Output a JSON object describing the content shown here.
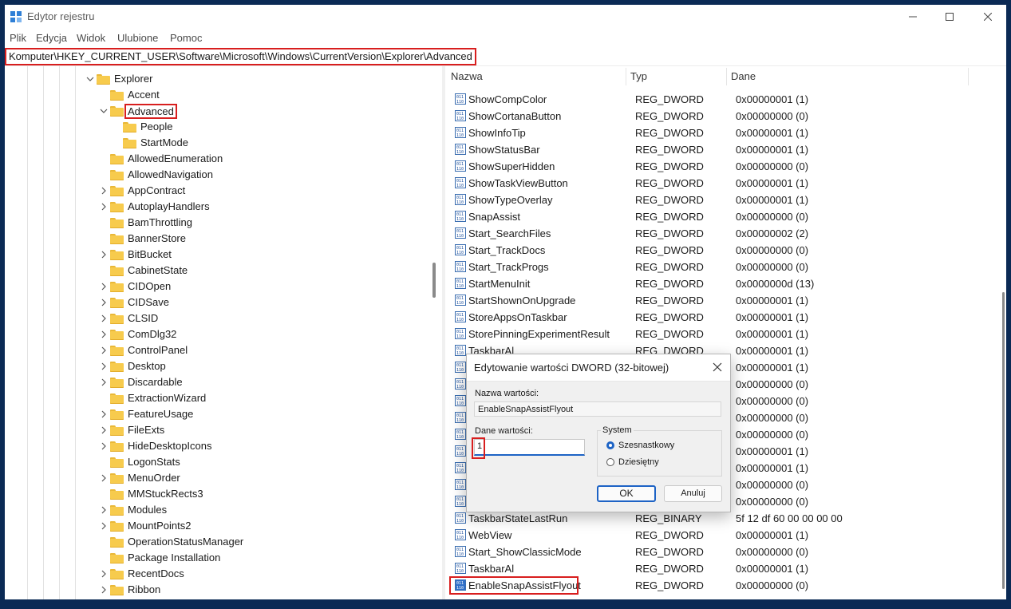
{
  "window": {
    "title": "Edytor rejestru"
  },
  "menu": [
    "Plik",
    "Edycja",
    "Widok",
    "Ulubione",
    "Pomoc"
  ],
  "address": "Komputer\\HKEY_CURRENT_USER\\Software\\Microsoft\\Windows\\CurrentVersion\\Explorer\\Advanced",
  "tree": {
    "parent": "Explorer",
    "children": [
      {
        "label": "Accent"
      },
      {
        "label": "Advanced",
        "highlighted": true,
        "expanded": true
      },
      {
        "label": "People"
      },
      {
        "label": "StartMode"
      },
      {
        "label": "AllowedEnumeration"
      },
      {
        "label": "AllowedNavigation"
      },
      {
        "label": "AppContract"
      },
      {
        "label": "AutoplayHandlers"
      },
      {
        "label": "BamThrottling"
      },
      {
        "label": "BannerStore"
      },
      {
        "label": "BitBucket"
      },
      {
        "label": "CabinetState"
      },
      {
        "label": "CIDOpen"
      },
      {
        "label": "CIDSave"
      },
      {
        "label": "CLSID"
      },
      {
        "label": "ComDlg32"
      },
      {
        "label": "ControlPanel"
      },
      {
        "label": "Desktop"
      },
      {
        "label": "Discardable"
      },
      {
        "label": "ExtractionWizard"
      },
      {
        "label": "FeatureUsage"
      },
      {
        "label": "FileExts"
      },
      {
        "label": "HideDesktopIcons"
      },
      {
        "label": "LogonStats"
      },
      {
        "label": "MenuOrder"
      },
      {
        "label": "MMStuckRects3"
      },
      {
        "label": "Modules"
      },
      {
        "label": "MountPoints2"
      },
      {
        "label": "OperationStatusManager"
      },
      {
        "label": "Package Installation"
      },
      {
        "label": "RecentDocs"
      },
      {
        "label": "Ribbon"
      }
    ]
  },
  "list": {
    "columns": [
      "Nazwa",
      "Typ",
      "Dane"
    ],
    "rows": [
      {
        "name": "ShowCompColor",
        "type": "REG_DWORD",
        "data": "0x00000001 (1)"
      },
      {
        "name": "ShowCortanaButton",
        "type": "REG_DWORD",
        "data": "0x00000000 (0)"
      },
      {
        "name": "ShowInfoTip",
        "type": "REG_DWORD",
        "data": "0x00000001 (1)"
      },
      {
        "name": "ShowStatusBar",
        "type": "REG_DWORD",
        "data": "0x00000001 (1)"
      },
      {
        "name": "ShowSuperHidden",
        "type": "REG_DWORD",
        "data": "0x00000000 (0)"
      },
      {
        "name": "ShowTaskViewButton",
        "type": "REG_DWORD",
        "data": "0x00000001 (1)"
      },
      {
        "name": "ShowTypeOverlay",
        "type": "REG_DWORD",
        "data": "0x00000001 (1)"
      },
      {
        "name": "SnapAssist",
        "type": "REG_DWORD",
        "data": "0x00000000 (0)"
      },
      {
        "name": "Start_SearchFiles",
        "type": "REG_DWORD",
        "data": "0x00000002 (2)"
      },
      {
        "name": "Start_TrackDocs",
        "type": "REG_DWORD",
        "data": "0x00000000 (0)"
      },
      {
        "name": "Start_TrackProgs",
        "type": "REG_DWORD",
        "data": "0x00000000 (0)"
      },
      {
        "name": "StartMenuInit",
        "type": "REG_DWORD",
        "data": "0x0000000d (13)"
      },
      {
        "name": "StartShownOnUpgrade",
        "type": "REG_DWORD",
        "data": "0x00000001 (1)"
      },
      {
        "name": "StoreAppsOnTaskbar",
        "type": "REG_DWORD",
        "data": "0x00000001 (1)"
      },
      {
        "name": "StorePinningExperimentResult",
        "type": "REG_DWORD",
        "data": "0x00000001 (1)"
      },
      {
        "name": "TaskbarAl",
        "type": "REG_DWORD",
        "data": "0x00000001 (1)"
      },
      {
        "name": "",
        "type": "",
        "data": "0x00000001 (1)"
      },
      {
        "name": "",
        "type": "",
        "data": "0x00000000 (0)"
      },
      {
        "name": "",
        "type": "",
        "data": "0x00000000 (0)"
      },
      {
        "name": "",
        "type": "",
        "data": "0x00000000 (0)"
      },
      {
        "name": "",
        "type": "",
        "data": "0x00000000 (0)"
      },
      {
        "name": "",
        "type": "",
        "data": "0x00000001 (1)"
      },
      {
        "name": "",
        "type": "",
        "data": "0x00000001 (1)"
      },
      {
        "name": "",
        "type": "",
        "data": "0x00000000 (0)"
      },
      {
        "name": "",
        "type": "",
        "data": "0x00000000 (0)"
      },
      {
        "name": "TaskbarStateLastRun",
        "type": "REG_BINARY",
        "data": "5f 12 df 60 00 00 00 00"
      },
      {
        "name": "WebView",
        "type": "REG_DWORD",
        "data": "0x00000001 (1)"
      },
      {
        "name": "Start_ShowClassicMode",
        "type": "REG_DWORD",
        "data": "0x00000000 (0)"
      },
      {
        "name": "TaskbarAl",
        "type": "REG_DWORD",
        "data": "0x00000001 (1)"
      },
      {
        "name": "EnableSnapAssistFlyout",
        "type": "REG_DWORD",
        "data": "0x00000000 (0)",
        "highlighted": true
      }
    ]
  },
  "dialog": {
    "title": "Edytowanie wartości DWORD (32-bitowej)",
    "name_label": "Nazwa wartości:",
    "name_value": "EnableSnapAssistFlyout",
    "data_label": "Dane wartości:",
    "data_value": "1",
    "base_label": "System",
    "base_options": [
      "Szesnastkowy",
      "Dziesiętny"
    ],
    "base_selected": "Szesnastkowy",
    "ok_label": "OK",
    "cancel_label": "Anuluj"
  },
  "colors": {
    "highlight": "#d81e1e",
    "accent": "#1d63c5",
    "folder": "#f7cb4d"
  }
}
